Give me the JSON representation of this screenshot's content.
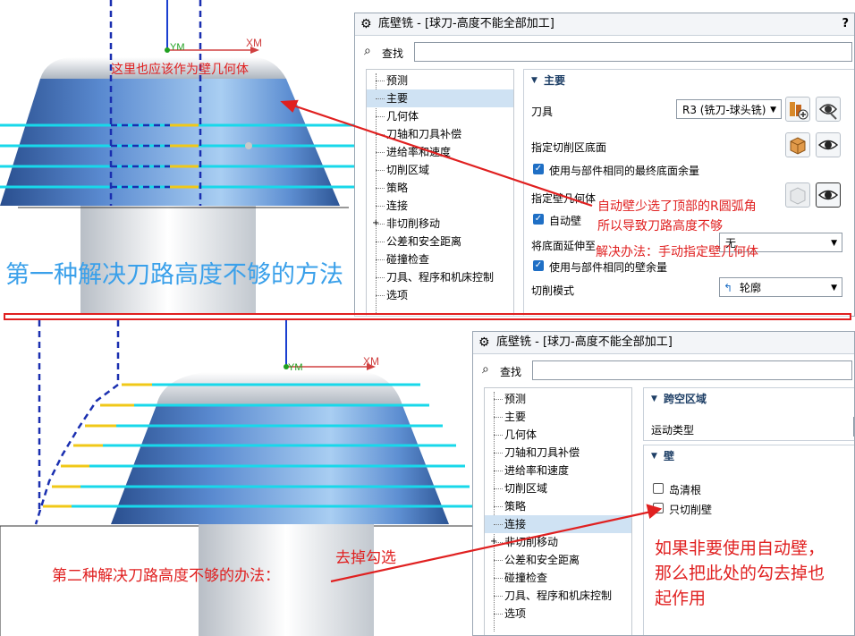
{
  "colors": {
    "annotation_red": "#e02020",
    "heading_blue": "#3aa0ea",
    "toolpath_cyan": "#18d8ea",
    "toolpath_yellow": "#f0c818",
    "boundary_blue": "#1a2fb0",
    "part_blue": "#4f7fc6",
    "select_blue": "#cfe2f3",
    "checkbox_blue": "#1f6fc5"
  },
  "viewport_top": {
    "axis_y_label": "YM",
    "axis_x_label": "XM",
    "note": "这里也应该作为壁几何体",
    "heading": "第一种解决刀路高度不够的方法"
  },
  "dialog_top": {
    "title": "底壁铣 - [球刀-高度不能全部加工]",
    "help": "?",
    "find_label": "查找",
    "find_value": "",
    "tree": [
      "预测",
      "主要",
      "几何体",
      "刀轴和刀具补偿",
      "进给率和速度",
      "切削区域",
      "策略",
      "连接",
      "非切削移动",
      "公差和安全距离",
      "碰撞检查",
      "刀具、程序和机床控制",
      "选项"
    ],
    "tree_selected": "主要",
    "section_title": "主要",
    "tool_label": "刀具",
    "tool_value": "R3 (铣刀-球头铣)",
    "floor_label": "指定切削区底面",
    "floor_stock_cb": "使用与部件相同的最终底面余量",
    "floor_stock_checked": true,
    "wall_label": "指定壁几何体",
    "autowall_cb": "自动壁",
    "autowall_checked": true,
    "extend_label": "将底面延伸至",
    "extend_value": "无",
    "wall_stock_cb": "使用与部件相同的壁余量",
    "wall_stock_checked": true,
    "cut_mode_label": "切削模式",
    "cut_mode_value": "轮廓"
  },
  "annotations_top": {
    "line1": "自动壁少选了顶部的R圆弧角",
    "line2": "所以导致刀路高度不够",
    "line3": "解决办法：手动指定壁几何体"
  },
  "viewport_bottom": {
    "axis_y_label": "YM",
    "axis_x_label": "XM",
    "heading": "第二种解决刀路高度不够的办法：",
    "note": "去掉勾选"
  },
  "dialog_bottom": {
    "title": "底壁铣 - [球刀-高度不能全部加工]",
    "find_label": "查找",
    "find_value": "",
    "tree": [
      "预测",
      "主要",
      "几何体",
      "刀轴和刀具补偿",
      "进给率和速度",
      "切削区域",
      "策略",
      "连接",
      "非切削移动",
      "公差和安全距离",
      "碰撞检查",
      "刀具、程序和机床控制",
      "选项"
    ],
    "tree_selected": "连接",
    "section1_title": "跨空区域",
    "motion_label": "运动类型",
    "section2_title": "壁",
    "island_cb": "岛清根",
    "island_checked": false,
    "wall_only_cb": "只切削壁",
    "wall_only_checked": false
  },
  "annotations_bottom": {
    "line1": "如果非要使用自动壁，",
    "line2": "那么把此处的勾去掉也",
    "line3": "起作用"
  },
  "icons": [
    "gear-icon",
    "binoculars-icon",
    "triangle-down-icon",
    "tool-new-icon",
    "tool-edit-icon",
    "select-face-icon",
    "eye-icon",
    "contour-icon",
    "checkmark-icon"
  ]
}
